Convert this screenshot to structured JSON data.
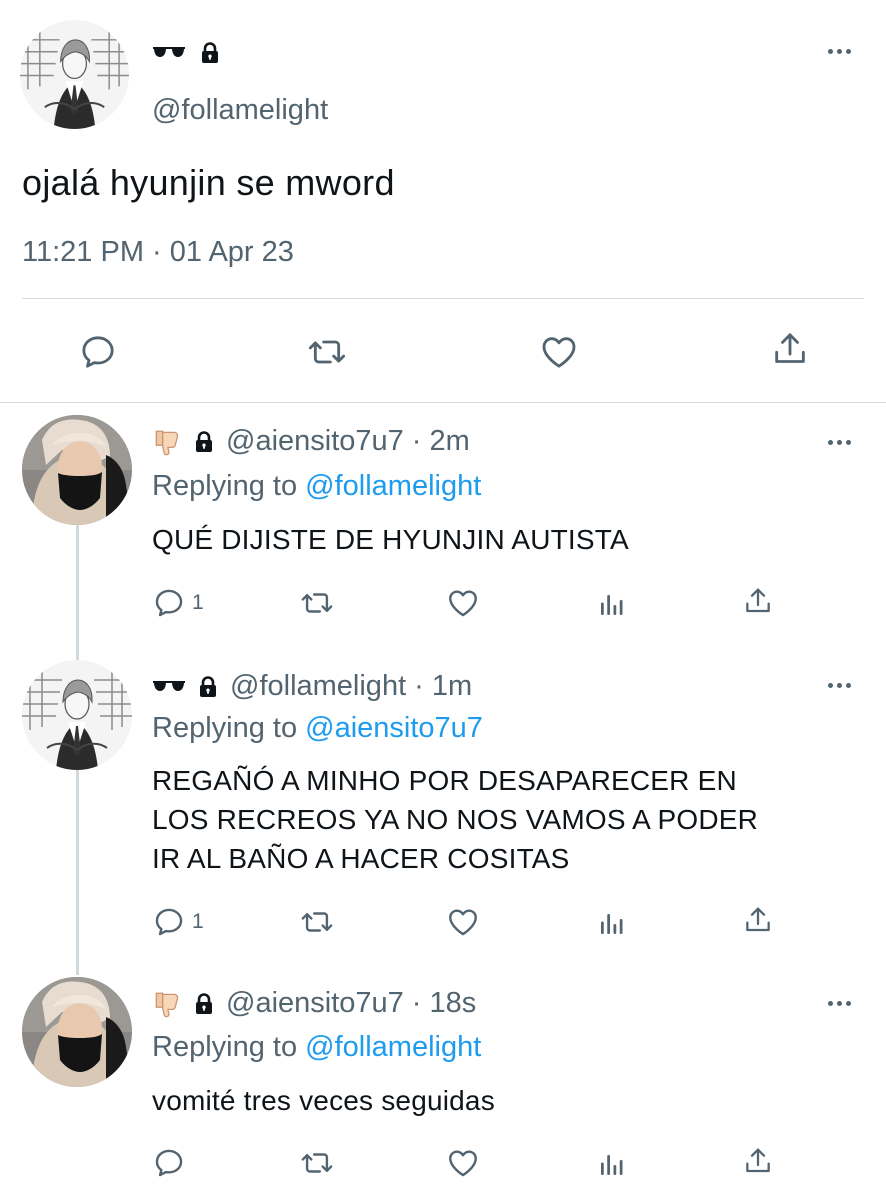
{
  "main_tweet": {
    "display_emoji": "🕶",
    "lock_icon": "lock-icon",
    "handle": "@follamelight",
    "text": "ojalá hyunjin se mword",
    "timestamp": "11:21 PM · 01 Apr 23",
    "actions": [
      "reply-icon",
      "retweet-icon",
      "like-icon",
      "share-icon"
    ]
  },
  "replies": [
    {
      "display_emoji": "👎🏻",
      "handle": "@aiensito7u7",
      "time": "· 2m",
      "replying_label": "Replying to",
      "replying_to": "@follamelight",
      "text": "QUÉ DIJISTE DE HYUNJIN AUTISTA",
      "reply_count": "1"
    },
    {
      "display_emoji": "🕶",
      "handle": "@follamelight",
      "time": "· 1m",
      "replying_label": "Replying to",
      "replying_to": "@aiensito7u7",
      "text_lines": [
        "REGAÑÓ A MINHO POR DESAPARECER EN",
        "LOS RECREOS YA NO NOS VAMOS A PODER",
        "IR AL BAÑO A HACER COSITAS"
      ],
      "reply_count": "1"
    },
    {
      "display_emoji": "👎🏻",
      "handle": "@aiensito7u7",
      "time": "· 18s",
      "replying_label": "Replying to",
      "replying_to": "@follamelight",
      "text": "vomité tres veces seguidas",
      "reply_count": ""
    }
  ],
  "colors": {
    "text": "#0f1419",
    "muted": "#536471",
    "link": "#1d9bf0",
    "divider": "#d6dbdf",
    "thread_line": "#cfd9de"
  }
}
